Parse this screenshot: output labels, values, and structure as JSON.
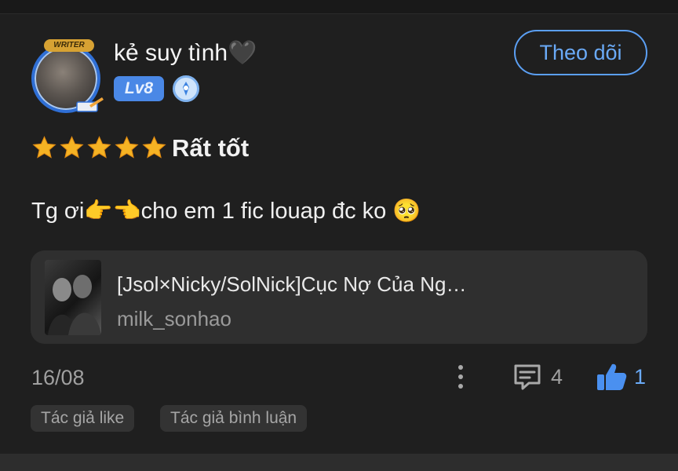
{
  "review": {
    "username": "kẻ suy tình🖤",
    "level_badge": "Lv8",
    "avatar_banner": "WRITER",
    "follow_label": "Theo dõi",
    "rating_stars": 5,
    "rating_label": "Rất tốt",
    "comment": "Tg ơi👉👈cho em 1 fic louap đc ko 🥺",
    "book": {
      "title": "[Jsol×Nicky/SolNick]Cục Nợ Của Ng…",
      "author": "milk_sonhao"
    },
    "date": "16/08",
    "comment_count": "4",
    "like_count": "1",
    "tags": [
      "Tác giả like",
      "Tác giả bình luận"
    ]
  },
  "icons": {
    "star": "star-icon",
    "more": "more-vertical-icon",
    "comment": "comment-icon",
    "like": "thumbs-up-icon",
    "medal": "medal-icon"
  },
  "colors": {
    "background": "#1f1f1f",
    "accent_blue": "#5b9ff3",
    "star_gold": "#f5b324",
    "card": "#2f2f2f",
    "muted_text": "#a0a0a0"
  }
}
